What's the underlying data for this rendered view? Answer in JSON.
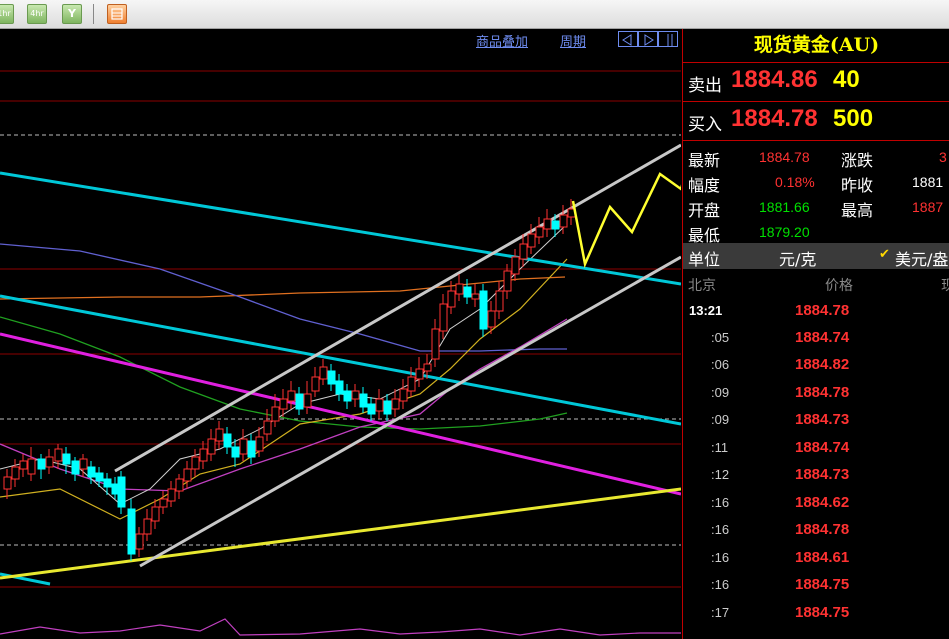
{
  "toolbar": {
    "buttons": [
      {
        "icon": "1hr-period-icon",
        "label": "1hr"
      },
      {
        "icon": "4hr-period-icon",
        "label": "4hr"
      },
      {
        "icon": "filter-icon",
        "label": "Y"
      },
      {
        "icon": "calendar-icon",
        "label": ""
      }
    ]
  },
  "chart_header": {
    "overlay_label": "商品叠加",
    "period_label": "周期",
    "nav_icons": [
      "scroll-left-icon",
      "scroll-right-icon",
      "layout-icon"
    ]
  },
  "quote": {
    "title": "现货黄金(AU)",
    "sell_label": "卖出",
    "sell_price": "1884.86",
    "sell_volume": "40",
    "buy_label": "买入",
    "buy_price": "1884.78",
    "buy_volume": "500",
    "stats": {
      "latest_label": "最新",
      "latest_value": "1884.78",
      "change_label": "涨跌",
      "change_value": "3",
      "amplitude_label": "幅度",
      "amplitude_value": "0.18%",
      "prev_close_label": "昨收",
      "prev_close_value": "1881",
      "open_label": "开盘",
      "open_value": "1881.66",
      "high_label": "最高",
      "high_value": "1887",
      "low_label": "最低",
      "low_value": "1879.20"
    },
    "unit_label": "单位",
    "unit_yuan": "元/克",
    "unit_usd": "美元/盎",
    "tick_header": {
      "location": "北京",
      "price": "价格",
      "extra": "现"
    },
    "ticks": [
      {
        "time": "13:21",
        "price": "1884.78"
      },
      {
        "time": ":05",
        "price": "1884.74"
      },
      {
        "time": ":06",
        "price": "1884.82"
      },
      {
        "time": ":09",
        "price": "1884.78"
      },
      {
        "time": ":09",
        "price": "1884.73"
      },
      {
        "time": ":11",
        "price": "1884.74"
      },
      {
        "time": ":12",
        "price": "1884.73"
      },
      {
        "time": ":16",
        "price": "1884.62"
      },
      {
        "time": ":16",
        "price": "1884.78"
      },
      {
        "time": ":16",
        "price": "1884.61"
      },
      {
        "time": ":16",
        "price": "1884.75"
      },
      {
        "time": ":17",
        "price": "1884.75"
      }
    ]
  },
  "colors": {
    "up": "#ff3232",
    "down": "#00ffff",
    "channel": "#c8c8c8",
    "trendline_cyan": "#00c8d8",
    "trendline_magenta": "#e020e0",
    "trendline_yellow": "#e8e830",
    "forecast_arrow": "#ffff30"
  }
}
